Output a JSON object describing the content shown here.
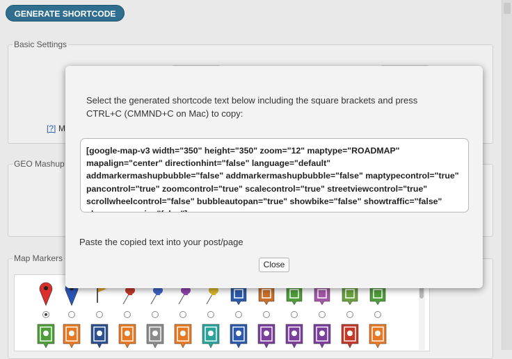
{
  "toolbar": {
    "generate_label": "GENERATE SHORTCODE"
  },
  "sections": {
    "basic": {
      "legend": "Basic Settings",
      "help_link": "[?]",
      "help_label_fragment": "M"
    },
    "geo": {
      "legend": "GEO Mashup"
    },
    "markers": {
      "legend": "Map Markers"
    }
  },
  "modal": {
    "instruction": "Select the generated shortcode text below including the square brackets and press CTRL+C (CMMND+C on Mac) to copy:",
    "shortcode": "[google-map-v3 width=\"350\" height=\"350\" zoom=\"12\" maptype=\"ROADMAP\" mapalign=\"center\" directionhint=\"false\" language=\"default\" addmarkermashupbubble=\"false\" addmarkermashupbubble=\"false\" maptypecontrol=\"true\" pancontrol=\"true\" zoomcontrol=\"true\" scalecontrol=\"true\" streetviewcontrol=\"true\" scrollwheelcontrol=\"false\" bubbleautopan=\"true\" showbike=\"false\" showtraffic=\"false\" showpanoramio=\"false\"]",
    "paste_note": "Paste the copied text into your post/page",
    "close_label": "Close"
  },
  "marker_row1": [
    {
      "icon": "red-map-pin-icon",
      "color": "#d9302c",
      "selected": true
    },
    {
      "icon": "blue-map-pin-icon",
      "color": "#2a55b8",
      "selected": false
    },
    {
      "icon": "flag-icon",
      "color": "#e2a22a",
      "selected": false
    },
    {
      "icon": "red-pushpin-icon",
      "color": "#c0392b",
      "selected": false
    },
    {
      "icon": "blue-pushpin-icon",
      "color": "#3d63c4",
      "selected": false
    },
    {
      "icon": "purple-pushpin-icon",
      "color": "#8e44ad",
      "selected": false
    },
    {
      "icon": "yellow-pushpin-icon",
      "color": "#d7b52a",
      "selected": false
    },
    {
      "icon": "airport-marker-icon",
      "color": "#2c5aa8",
      "selected": false
    },
    {
      "icon": "airplane-marker-icon",
      "color": "#c8702a",
      "selected": false
    },
    {
      "icon": "recycle-marker-icon",
      "color": "#4f9d3a",
      "selected": false
    },
    {
      "icon": "cake-marker-icon",
      "color": "#a457a8",
      "selected": false
    },
    {
      "icon": "building-marker-icon",
      "color": "#6aa040",
      "selected": false
    },
    {
      "icon": "apple-marker-icon",
      "color": "#4f9d3a",
      "selected": false
    }
  ],
  "marker_row2": [
    {
      "icon": "arch-marker-icon",
      "color": "#4f9d3a"
    },
    {
      "icon": "person-marker-icon",
      "color": "#e47a25"
    },
    {
      "icon": "police-badge-marker-icon",
      "color": "#2c4f8e"
    },
    {
      "icon": "motorcycle-marker-icon",
      "color": "#e47a25"
    },
    {
      "icon": "speaker-marker-icon",
      "color": "#8a8a8a"
    },
    {
      "icon": "dancer-marker-icon",
      "color": "#e47a25"
    },
    {
      "icon": "bag-marker-icon",
      "color": "#2aa39a"
    },
    {
      "icon": "money-bag-marker-icon",
      "color": "#2c5aa8"
    },
    {
      "icon": "bottles-marker-icon",
      "color": "#7a3f9a"
    },
    {
      "icon": "beer-mug-marker-icon",
      "color": "#7a3f9a"
    },
    {
      "icon": "grill-marker-icon",
      "color": "#7a3f9a"
    },
    {
      "icon": "barber-marker-icon",
      "color": "#c0392b"
    },
    {
      "icon": "hiker-marker-icon",
      "color": "#e47a25"
    }
  ]
}
